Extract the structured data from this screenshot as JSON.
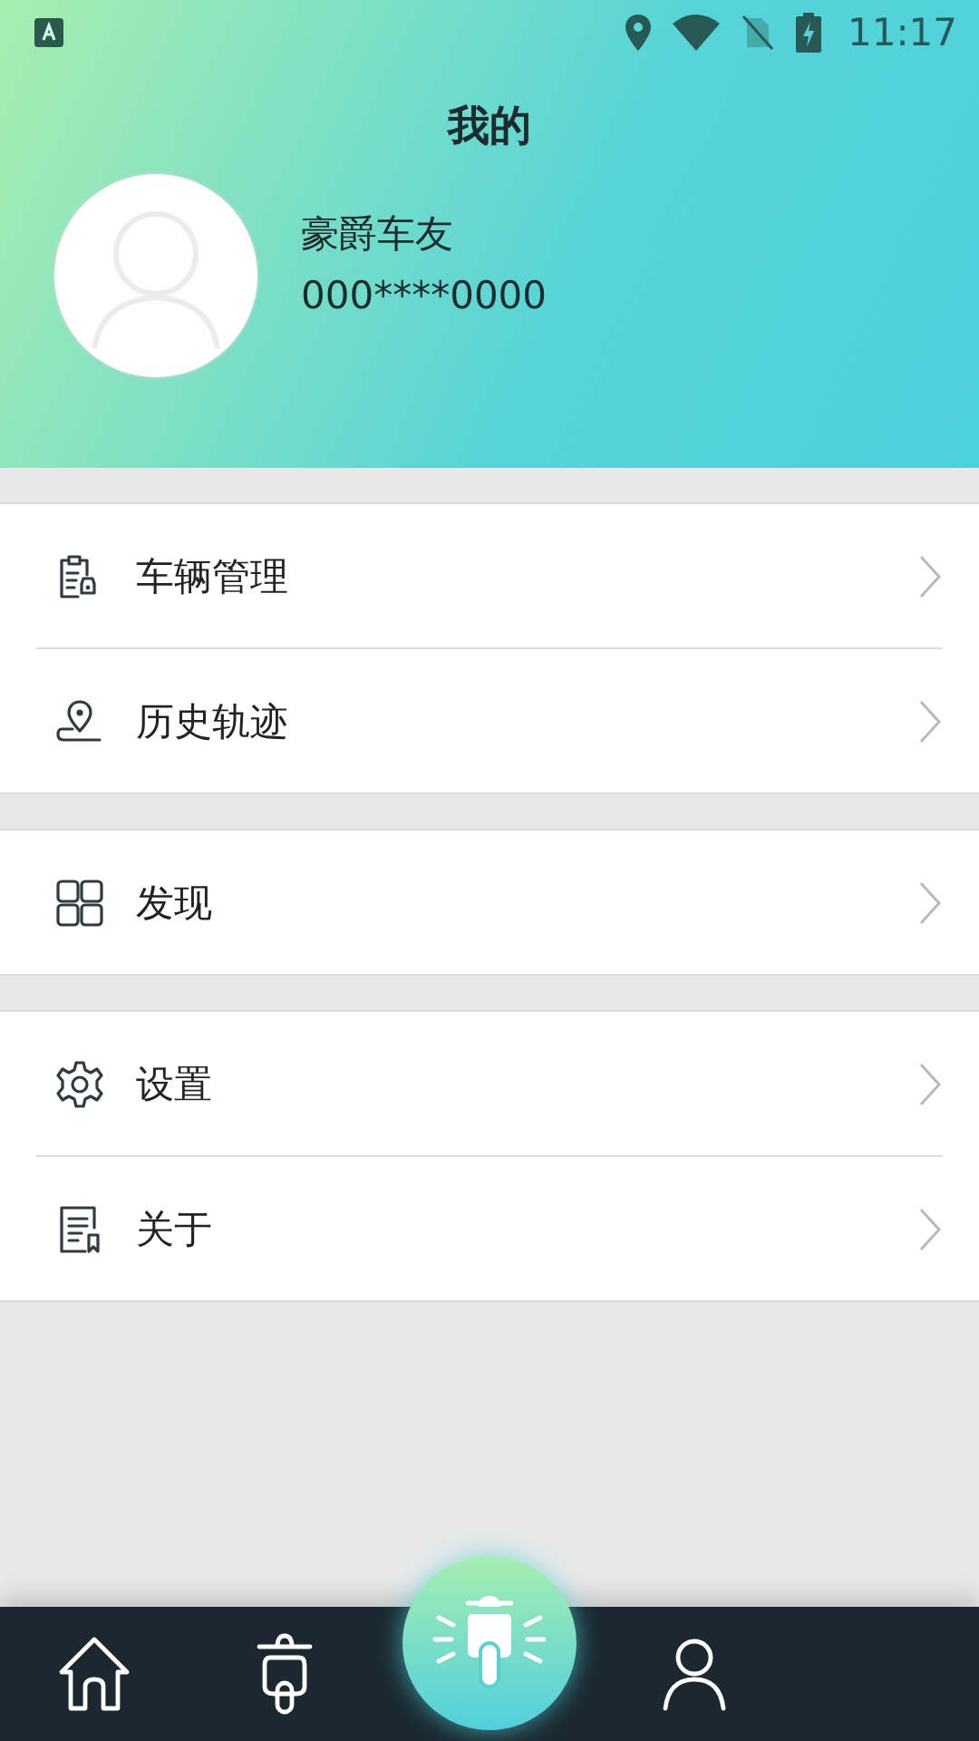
{
  "status_bar": {
    "time": "11:17"
  },
  "title": "我的",
  "profile": {
    "name": "豪爵车友",
    "phone": "000****0000"
  },
  "sections": [
    {
      "items": [
        {
          "kind": "vehicle",
          "label": "车辆管理"
        },
        {
          "kind": "track",
          "label": "历史轨迹"
        }
      ]
    },
    {
      "items": [
        {
          "kind": "discover",
          "label": "发现"
        }
      ]
    },
    {
      "items": [
        {
          "kind": "settings",
          "label": "设置"
        },
        {
          "kind": "about",
          "label": "关于"
        }
      ]
    }
  ],
  "bottom_nav": [
    {
      "kind": "home"
    },
    {
      "kind": "scooter"
    },
    {
      "kind": "center"
    },
    {
      "kind": "profile"
    }
  ]
}
